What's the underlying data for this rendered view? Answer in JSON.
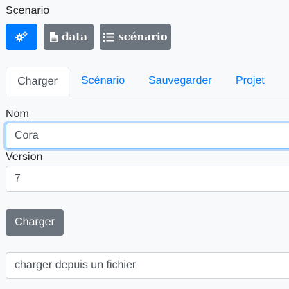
{
  "header": {
    "title": "Scenario"
  },
  "toolbar": {
    "gear_icon": "gears-icon",
    "data_label": "data",
    "data_icon": "file-icon",
    "scenario_label": "scénario",
    "scenario_icon": "list-icon",
    "accent_color": "#007bff",
    "secondary_color": "#6c757d"
  },
  "tabs": [
    {
      "label": "Charger",
      "active": true
    },
    {
      "label": "Scénario",
      "active": false
    },
    {
      "label": "Sauvegarder",
      "active": false
    },
    {
      "label": "Projet",
      "active": false
    }
  ],
  "form": {
    "name_label": "Nom",
    "name_value": "Cora",
    "version_label": "Version",
    "version_value": "7",
    "load_button": "Charger",
    "file_field": "charger depuis un fichier"
  }
}
